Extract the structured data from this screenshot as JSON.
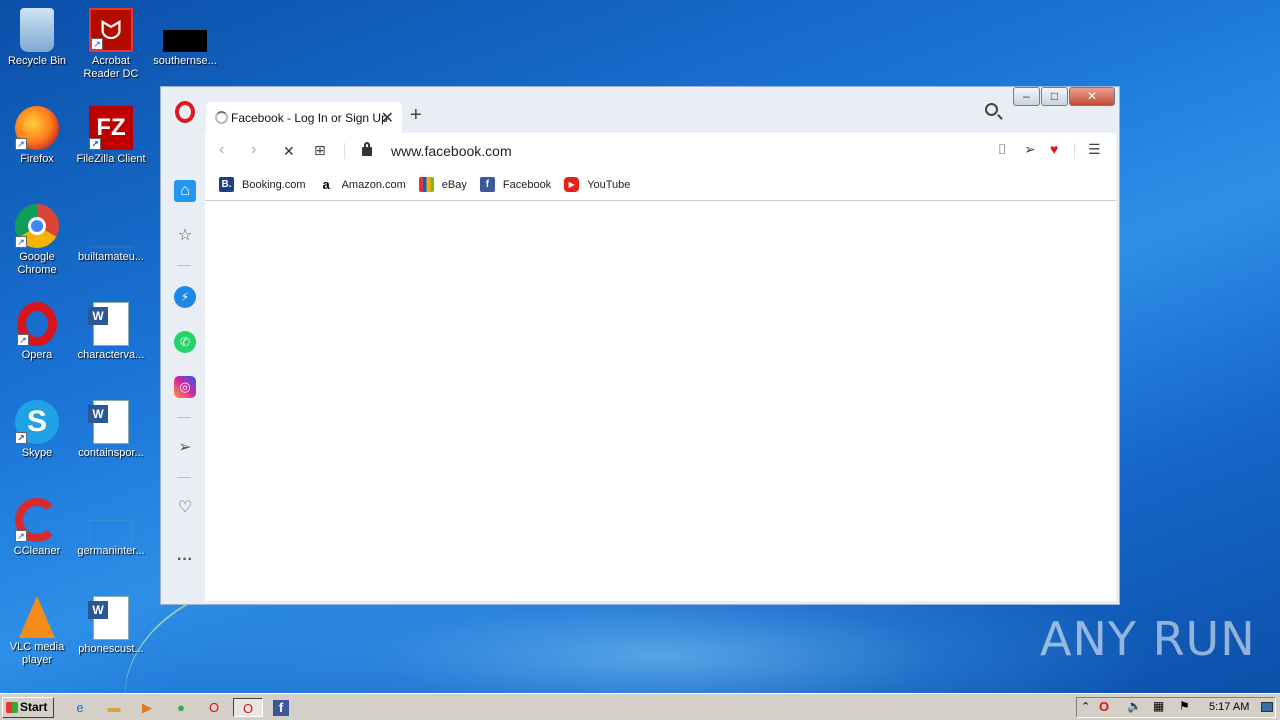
{
  "desktop": {
    "icons": [
      {
        "label": "Recycle Bin"
      },
      {
        "label": "Acrobat Reader DC"
      },
      {
        "label": "southernse..."
      },
      {
        "label": "Firefox"
      },
      {
        "label": "FileZilla Client"
      },
      {
        "label": "Google Chrome"
      },
      {
        "label": "builtamateu..."
      },
      {
        "label": "Opera"
      },
      {
        "label": "characterva..."
      },
      {
        "label": "Skype"
      },
      {
        "label": "containspor..."
      },
      {
        "label": "CCleaner"
      },
      {
        "label": "germaninter..."
      },
      {
        "label": "VLC media player"
      },
      {
        "label": "phonescust..."
      }
    ]
  },
  "browser": {
    "tab_title": "Facebook - Log In or Sign Up",
    "url": "www.facebook.com",
    "bookmarks": [
      {
        "label": "Booking.com",
        "icon": "booking-icon",
        "color": "#1d3f80",
        "glyph": "B."
      },
      {
        "label": "Amazon.com",
        "icon": "amazon-icon",
        "color": "#ffffff",
        "glyph": "a"
      },
      {
        "label": "eBay",
        "icon": "ebay-icon",
        "color": "#e53238",
        "glyph": ""
      },
      {
        "label": "Facebook",
        "icon": "facebook-icon",
        "color": "#3b5998",
        "glyph": "f"
      },
      {
        "label": "YouTube",
        "icon": "youtube-icon",
        "color": "#e62117",
        "glyph": "▶"
      }
    ]
  },
  "taskbar": {
    "start_label": "Start",
    "clock": "5:17 AM"
  },
  "watermark": "ANY RUN"
}
